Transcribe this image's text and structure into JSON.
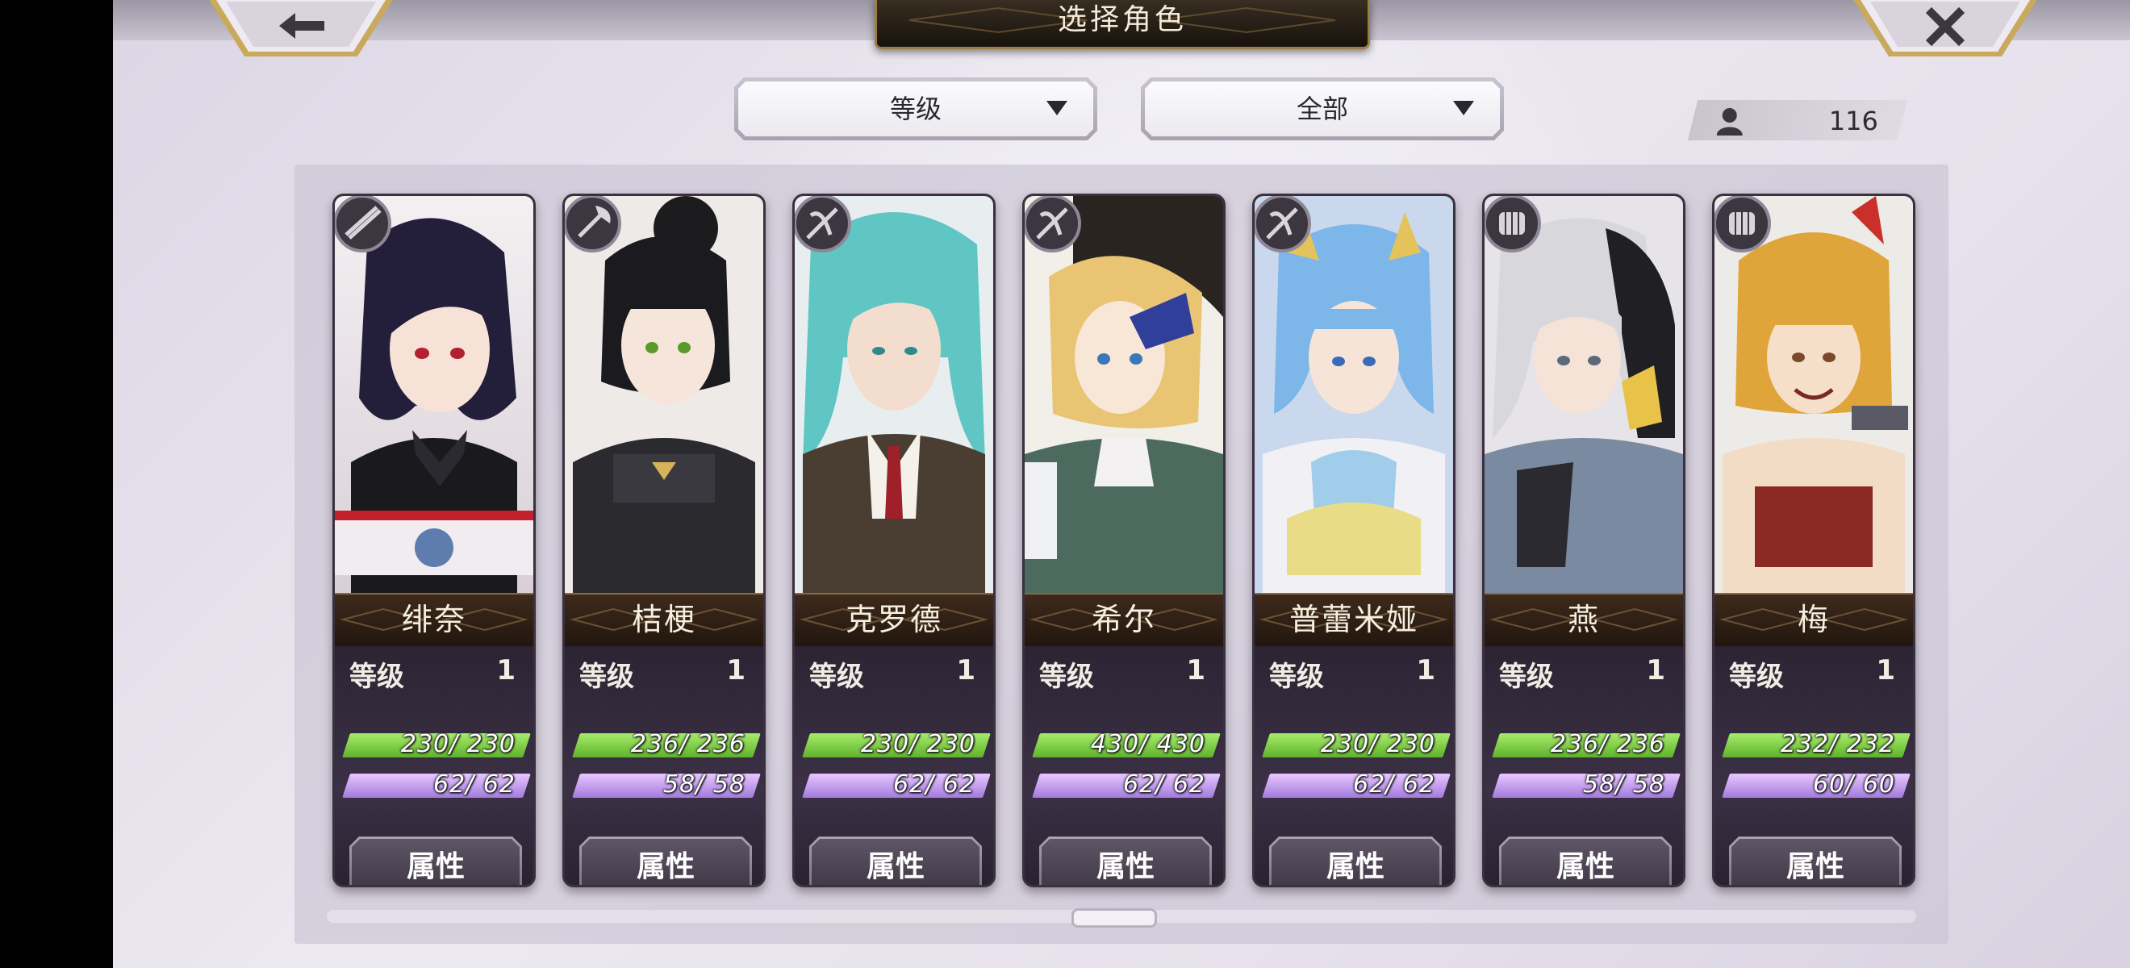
{
  "header": {
    "title": "选择角色"
  },
  "filters": {
    "sort_label": "等级",
    "category_label": "全部"
  },
  "roster_count": "116",
  "characters": [
    {
      "name": "绯奈",
      "level_label": "等级",
      "level": "1",
      "hp": "230/ 230",
      "mp": "62/ 62",
      "button": "属性",
      "class_icon": "katana-icon"
    },
    {
      "name": "桔梗",
      "level_label": "等级",
      "level": "1",
      "hp": "236/ 236",
      "mp": "58/ 58",
      "button": "属性",
      "class_icon": "axe-icon"
    },
    {
      "name": "克罗德",
      "level_label": "等级",
      "level": "1",
      "hp": "230/ 230",
      "mp": "62/ 62",
      "button": "属性",
      "class_icon": "crossbow-icon"
    },
    {
      "name": "希尔",
      "level_label": "等级",
      "level": "1",
      "hp": "430/ 430",
      "mp": "62/ 62",
      "button": "属性",
      "class_icon": "crossbow-icon"
    },
    {
      "name": "普蕾米娅",
      "level_label": "等级",
      "level": "1",
      "hp": "230/ 230",
      "mp": "62/ 62",
      "button": "属性",
      "class_icon": "crossbow-icon"
    },
    {
      "name": "燕",
      "level_label": "等级",
      "level": "1",
      "hp": "236/ 236",
      "mp": "58/ 58",
      "button": "属性",
      "class_icon": "fist-icon"
    },
    {
      "name": "梅",
      "level_label": "等级",
      "level": "1",
      "hp": "232/ 232",
      "mp": "60/ 60",
      "button": "属性",
      "class_icon": "fist-icon"
    }
  ],
  "icons": {
    "back": "back-arrow-icon",
    "close": "close-icon",
    "dropdown": "caret-down-icon",
    "count": "person-icon"
  },
  "colors": {
    "hp_bar": "#7fd44a",
    "mp_bar": "#c4a2f0",
    "name_bar": "#2f2116",
    "accent_gold": "#c9a24a"
  }
}
